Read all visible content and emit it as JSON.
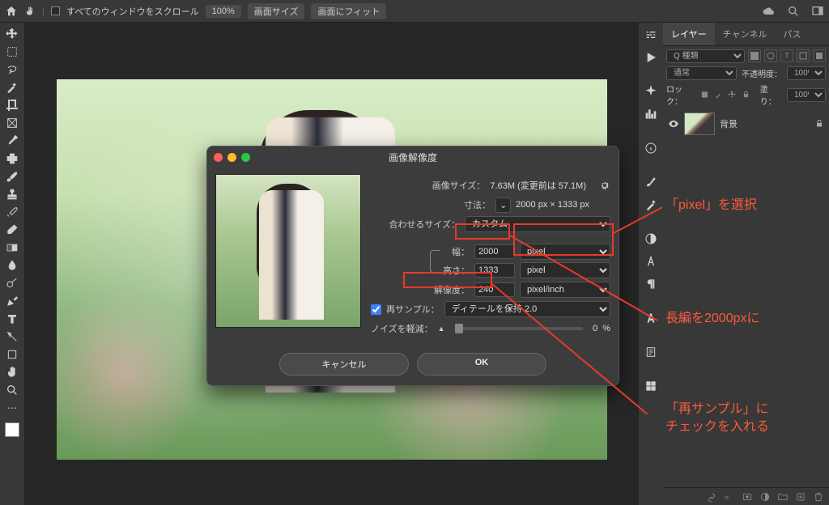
{
  "topbar": {
    "scroll_label": "すべてのウィンドウをスクロール",
    "zoom": "100%",
    "fit_screen": "画面サイズ",
    "fit_window": "画面にフィット"
  },
  "layers": {
    "tabs": [
      "レイヤー",
      "チャンネル",
      "パス"
    ],
    "search_kind": "Q 種類",
    "blend": "通常",
    "opacity_label": "不透明度：",
    "opacity_val": "100%",
    "lock_label": "ロック：",
    "fill_label": "塗り：",
    "fill_val": "100%",
    "layer_name": "背景"
  },
  "dialog": {
    "title": "画像解像度",
    "image_size_label": "画像サイズ：",
    "image_size_val": "7.63M (変更前は 57.1M)",
    "dimensions_label": "寸法：",
    "dimensions_val": "2000 px × 1333 px",
    "fit_label": "合わせるサイズ：",
    "fit_val": "カスタム",
    "width_label": "幅：",
    "width_val": "2000",
    "width_unit": "pixel",
    "height_label": "高さ：",
    "height_val": "1333",
    "height_unit": "pixel",
    "resolution_label": "解像度：",
    "resolution_val": "240",
    "resolution_unit": "pixel/inch",
    "resample_label": "再サンプル：",
    "resample_val": "ディテールを保持 2.0",
    "noise_label": "ノイズを軽減：",
    "noise_val": "0",
    "noise_pct": "%",
    "cancel": "キャンセル",
    "ok": "OK"
  },
  "annot": {
    "a1": "「pixel」を選択",
    "a2": "長編を2000pxに",
    "a3_l1": "「再サンプル」に",
    "a3_l2": "チェックを入れる"
  }
}
